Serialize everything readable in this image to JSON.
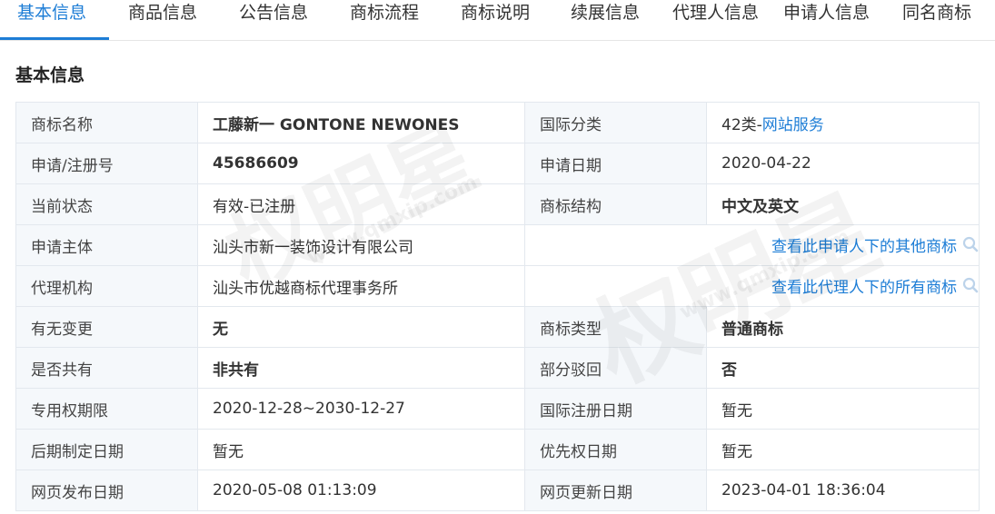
{
  "tabs": [
    {
      "label": "基本信息",
      "active": true
    },
    {
      "label": "商品信息"
    },
    {
      "label": "公告信息"
    },
    {
      "label": "商标流程"
    },
    {
      "label": "商标说明"
    },
    {
      "label": "续展信息"
    },
    {
      "label": "代理人信息"
    },
    {
      "label": "申请人信息"
    },
    {
      "label": "同名商标"
    }
  ],
  "section_title": "基本信息",
  "info": {
    "name_label": "商标名称",
    "name_value": "工藤新一 GONTONE NEWONES",
    "intl_class_label": "国际分类",
    "intl_class_prefix": "42类-",
    "intl_class_link": "网站服务",
    "reg_no_label": "申请/注册号",
    "reg_no_value": "45686609",
    "apply_date_label": "申请日期",
    "apply_date_value": "2020-04-22",
    "status_label": "当前状态",
    "status_value": "有效-已注册",
    "structure_label": "商标结构",
    "structure_value": "中文及英文",
    "applicant_label": "申请主体",
    "applicant_value": "汕头市新一装饰设计有限公司",
    "applicant_link": "查看此申请人下的其他商标",
    "agency_label": "代理机构",
    "agency_value": "汕头市优越商标代理事务所",
    "agency_link": "查看此代理人下的所有商标",
    "change_label": "有无变更",
    "change_value": "无",
    "type_label": "商标类型",
    "type_value": "普通商标",
    "shared_label": "是否共有",
    "shared_value": "非共有",
    "reject_label": "部分驳回",
    "reject_value": "否",
    "period_label": "专用权期限",
    "period_value": "2020-12-28~2030-12-27",
    "intl_reg_date_label": "国际注册日期",
    "intl_reg_date_value": "暂无",
    "later_date_label": "后期制定日期",
    "later_date_value": "暂无",
    "priority_date_label": "优先权日期",
    "priority_date_value": "暂无",
    "publish_label": "网页发布日期",
    "publish_value": "2020-05-08 01:13:09",
    "update_label": "网页更新日期",
    "update_value": "2023-04-01 18:36:04"
  },
  "watermark": {
    "text1": "权明星",
    "text2": "www.qmxip.com"
  },
  "colors": {
    "accent": "#1d7dd6",
    "label_bg": "#f5f8fb",
    "border": "#e3e8ee"
  },
  "icons": {
    "search": "search-icon"
  }
}
